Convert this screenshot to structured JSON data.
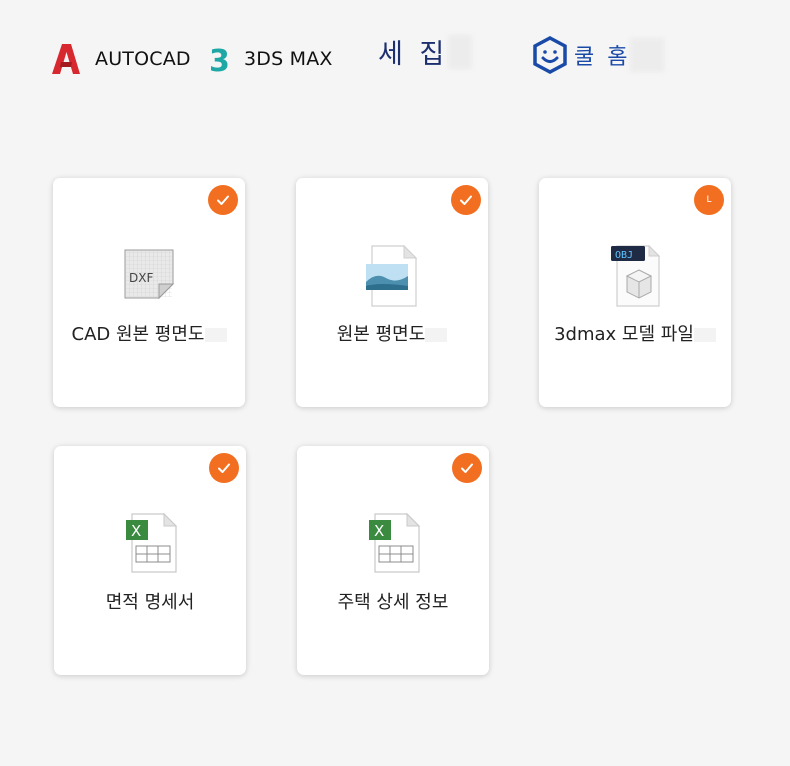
{
  "header": {
    "brands": [
      {
        "label": "AUTOCAD",
        "icon": "autocad-logo-icon",
        "color": "#d7282f"
      },
      {
        "label": "3DS MAX",
        "icon": "3dsmax-logo-icon",
        "color": "#1fa7a6"
      },
      {
        "label": "세 집",
        "icon": "",
        "color": "#1d2f6f"
      },
      {
        "label": "쿨 홈",
        "icon": "kool-home-logo-icon",
        "color": "#1a4aa8"
      }
    ]
  },
  "cards": [
    {
      "label": "CAD 원본 평면도",
      "icon": "dxf-file-icon",
      "icon_text": "DXF",
      "badge": "check"
    },
    {
      "label": "원본 평면도",
      "icon": "image-file-icon",
      "badge": "check"
    },
    {
      "label": "3dmax 모델 파일",
      "icon": "obj-file-icon",
      "icon_text": "OBJ",
      "badge": "L"
    },
    {
      "label": "면적 명세서",
      "icon": "excel-file-icon",
      "icon_text": "X",
      "badge": "check"
    },
    {
      "label": "주택 상세 정보",
      "icon": "excel-file-icon",
      "icon_text": "X",
      "badge": "check"
    }
  ],
  "colors": {
    "accent": "#f26f21",
    "background": "#f5f5f5",
    "card": "#ffffff"
  }
}
